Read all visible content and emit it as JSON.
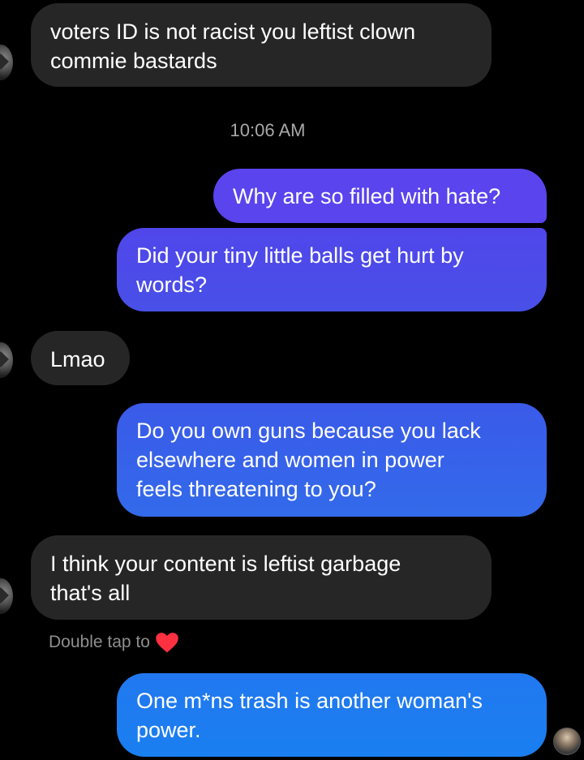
{
  "thread": {
    "timestamp": "10:06 AM",
    "double_tap_hint": "Double tap to",
    "heart_icon": "heart-icon",
    "messages": [
      {
        "from": "them",
        "text": "voters ID is not racist you leftist clown\ncommie bastards"
      },
      {
        "from": "me",
        "text": "Why are so filled with hate?"
      },
      {
        "from": "me",
        "text": "Did your tiny little balls get hurt by\nwords?"
      },
      {
        "from": "them",
        "text": "Lmao"
      },
      {
        "from": "me",
        "text": "Do you own guns because you lack\nelsewhere and women in power\nfeels threatening to you?"
      },
      {
        "from": "them",
        "text": "I think your content is leftist garbage\nthat's all"
      },
      {
        "from": "me",
        "text": "One m*ns trash is another woman's\npower."
      }
    ]
  },
  "colors": {
    "background": "#000000",
    "incoming_bubble": "#262626",
    "outgoing_gradient_top": "#6b37f2",
    "outgoing_gradient_bottom": "#1a7cf2",
    "heart": "#ff3040"
  }
}
